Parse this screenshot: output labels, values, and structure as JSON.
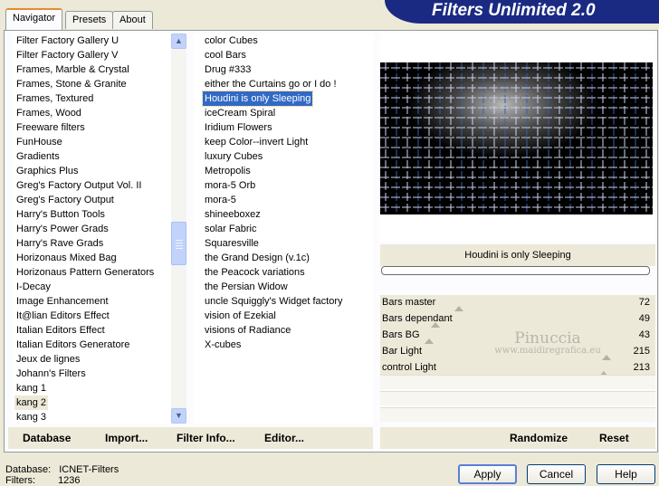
{
  "tabs": [
    "Navigator",
    "Presets",
    "About"
  ],
  "app_title": "Filters Unlimited 2.0",
  "categories": [
    "Filter Factory Gallery U",
    "Filter Factory Gallery V",
    "Frames, Marble & Crystal",
    "Frames, Stone & Granite",
    "Frames, Textured",
    "Frames, Wood",
    "Freeware filters",
    "FunHouse",
    "Gradients",
    "Graphics Plus",
    "Greg's Factory Output Vol. II",
    "Greg's Factory Output",
    "Harry's Button Tools",
    "Harry's Power Grads",
    "Harry's Rave Grads",
    "Horizonaus Mixed Bag",
    "Horizonaus Pattern Generators",
    "I-Decay",
    "Image Enhancement",
    "It@lian Editors Effect",
    "Italian Editors Effect",
    "Italian Editors Generatore",
    "Jeux de lignes",
    "Johann's Filters",
    "kang 1",
    "kang 2",
    "kang 3"
  ],
  "selected_category": "kang 2",
  "filters": [
    "color Cubes",
    "cool Bars",
    "Drug #333",
    "either the Curtains go or I do !",
    "Houdini is only Sleeping",
    "iceCream Spiral",
    "Iridium Flowers",
    "keep Color--invert Light",
    "luxury Cubes",
    "Metropolis",
    "mora-5 Orb",
    "mora-5",
    "shineeboxez",
    "solar Fabric",
    "Squaresville",
    "the Grand Design      (v.1c)",
    "the Peacock variations",
    "the Persian Widow",
    "uncle Squiggly's Widget factory",
    "vision of Ezekial",
    "visions of Radiance",
    "X-cubes"
  ],
  "selected_filter": "Houdini is only Sleeping",
  "preview_caption": "Houdini is only Sleeping",
  "sliders": [
    {
      "label": "Bars master",
      "value": "72",
      "level": 72
    },
    {
      "label": "Bars dependant",
      "value": "49",
      "level": 49
    },
    {
      "label": "Bars BG",
      "value": "43",
      "level": 43
    },
    {
      "label": "Bar Light",
      "value": "215",
      "level": 215
    },
    {
      "label": "control Light",
      "value": "213",
      "level": 213
    }
  ],
  "watermark": {
    "name": "Pinuccia",
    "site": "www.maidiregrafica.eu"
  },
  "toolbar": {
    "database": "Database",
    "import": "Import...",
    "filter_info": "Filter Info...",
    "editor": "Editor...",
    "randomize": "Randomize",
    "reset": "Reset"
  },
  "status": {
    "database_label": "Database:",
    "database_value": "ICNET-Filters",
    "filters_label": "Filters:",
    "filters_value": "1236"
  },
  "buttons": {
    "apply": "Apply",
    "cancel": "Cancel",
    "help": "Help"
  }
}
